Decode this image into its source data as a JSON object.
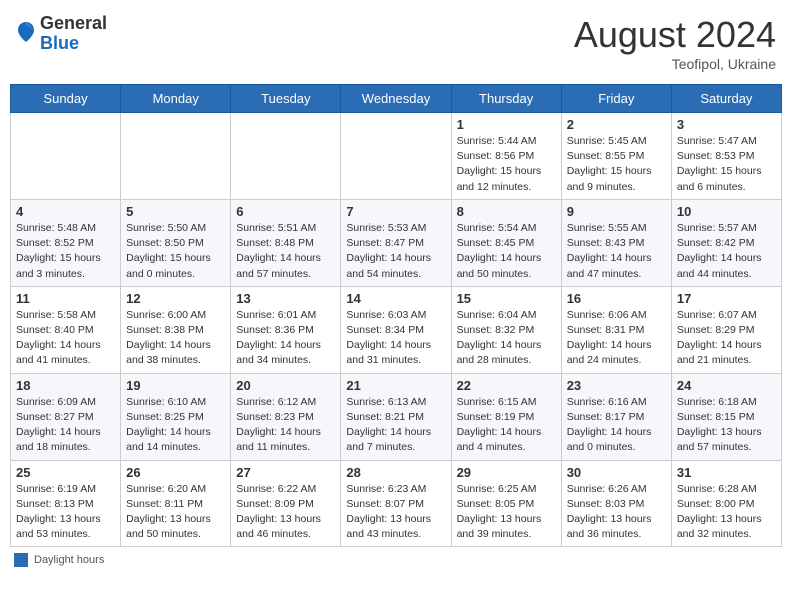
{
  "header": {
    "logo_general": "General",
    "logo_blue": "Blue",
    "month_year": "August 2024",
    "location": "Teofipol, Ukraine"
  },
  "days_of_week": [
    "Sunday",
    "Monday",
    "Tuesday",
    "Wednesday",
    "Thursday",
    "Friday",
    "Saturday"
  ],
  "footer": {
    "legend_label": "Daylight hours"
  },
  "weeks": [
    [
      {
        "day": "",
        "info": ""
      },
      {
        "day": "",
        "info": ""
      },
      {
        "day": "",
        "info": ""
      },
      {
        "day": "",
        "info": ""
      },
      {
        "day": "1",
        "info": "Sunrise: 5:44 AM\nSunset: 8:56 PM\nDaylight: 15 hours\nand 12 minutes."
      },
      {
        "day": "2",
        "info": "Sunrise: 5:45 AM\nSunset: 8:55 PM\nDaylight: 15 hours\nand 9 minutes."
      },
      {
        "day": "3",
        "info": "Sunrise: 5:47 AM\nSunset: 8:53 PM\nDaylight: 15 hours\nand 6 minutes."
      }
    ],
    [
      {
        "day": "4",
        "info": "Sunrise: 5:48 AM\nSunset: 8:52 PM\nDaylight: 15 hours\nand 3 minutes."
      },
      {
        "day": "5",
        "info": "Sunrise: 5:50 AM\nSunset: 8:50 PM\nDaylight: 15 hours\nand 0 minutes."
      },
      {
        "day": "6",
        "info": "Sunrise: 5:51 AM\nSunset: 8:48 PM\nDaylight: 14 hours\nand 57 minutes."
      },
      {
        "day": "7",
        "info": "Sunrise: 5:53 AM\nSunset: 8:47 PM\nDaylight: 14 hours\nand 54 minutes."
      },
      {
        "day": "8",
        "info": "Sunrise: 5:54 AM\nSunset: 8:45 PM\nDaylight: 14 hours\nand 50 minutes."
      },
      {
        "day": "9",
        "info": "Sunrise: 5:55 AM\nSunset: 8:43 PM\nDaylight: 14 hours\nand 47 minutes."
      },
      {
        "day": "10",
        "info": "Sunrise: 5:57 AM\nSunset: 8:42 PM\nDaylight: 14 hours\nand 44 minutes."
      }
    ],
    [
      {
        "day": "11",
        "info": "Sunrise: 5:58 AM\nSunset: 8:40 PM\nDaylight: 14 hours\nand 41 minutes."
      },
      {
        "day": "12",
        "info": "Sunrise: 6:00 AM\nSunset: 8:38 PM\nDaylight: 14 hours\nand 38 minutes."
      },
      {
        "day": "13",
        "info": "Sunrise: 6:01 AM\nSunset: 8:36 PM\nDaylight: 14 hours\nand 34 minutes."
      },
      {
        "day": "14",
        "info": "Sunrise: 6:03 AM\nSunset: 8:34 PM\nDaylight: 14 hours\nand 31 minutes."
      },
      {
        "day": "15",
        "info": "Sunrise: 6:04 AM\nSunset: 8:32 PM\nDaylight: 14 hours\nand 28 minutes."
      },
      {
        "day": "16",
        "info": "Sunrise: 6:06 AM\nSunset: 8:31 PM\nDaylight: 14 hours\nand 24 minutes."
      },
      {
        "day": "17",
        "info": "Sunrise: 6:07 AM\nSunset: 8:29 PM\nDaylight: 14 hours\nand 21 minutes."
      }
    ],
    [
      {
        "day": "18",
        "info": "Sunrise: 6:09 AM\nSunset: 8:27 PM\nDaylight: 14 hours\nand 18 minutes."
      },
      {
        "day": "19",
        "info": "Sunrise: 6:10 AM\nSunset: 8:25 PM\nDaylight: 14 hours\nand 14 minutes."
      },
      {
        "day": "20",
        "info": "Sunrise: 6:12 AM\nSunset: 8:23 PM\nDaylight: 14 hours\nand 11 minutes."
      },
      {
        "day": "21",
        "info": "Sunrise: 6:13 AM\nSunset: 8:21 PM\nDaylight: 14 hours\nand 7 minutes."
      },
      {
        "day": "22",
        "info": "Sunrise: 6:15 AM\nSunset: 8:19 PM\nDaylight: 14 hours\nand 4 minutes."
      },
      {
        "day": "23",
        "info": "Sunrise: 6:16 AM\nSunset: 8:17 PM\nDaylight: 14 hours\nand 0 minutes."
      },
      {
        "day": "24",
        "info": "Sunrise: 6:18 AM\nSunset: 8:15 PM\nDaylight: 13 hours\nand 57 minutes."
      }
    ],
    [
      {
        "day": "25",
        "info": "Sunrise: 6:19 AM\nSunset: 8:13 PM\nDaylight: 13 hours\nand 53 minutes."
      },
      {
        "day": "26",
        "info": "Sunrise: 6:20 AM\nSunset: 8:11 PM\nDaylight: 13 hours\nand 50 minutes."
      },
      {
        "day": "27",
        "info": "Sunrise: 6:22 AM\nSunset: 8:09 PM\nDaylight: 13 hours\nand 46 minutes."
      },
      {
        "day": "28",
        "info": "Sunrise: 6:23 AM\nSunset: 8:07 PM\nDaylight: 13 hours\nand 43 minutes."
      },
      {
        "day": "29",
        "info": "Sunrise: 6:25 AM\nSunset: 8:05 PM\nDaylight: 13 hours\nand 39 minutes."
      },
      {
        "day": "30",
        "info": "Sunrise: 6:26 AM\nSunset: 8:03 PM\nDaylight: 13 hours\nand 36 minutes."
      },
      {
        "day": "31",
        "info": "Sunrise: 6:28 AM\nSunset: 8:00 PM\nDaylight: 13 hours\nand 32 minutes."
      }
    ]
  ]
}
